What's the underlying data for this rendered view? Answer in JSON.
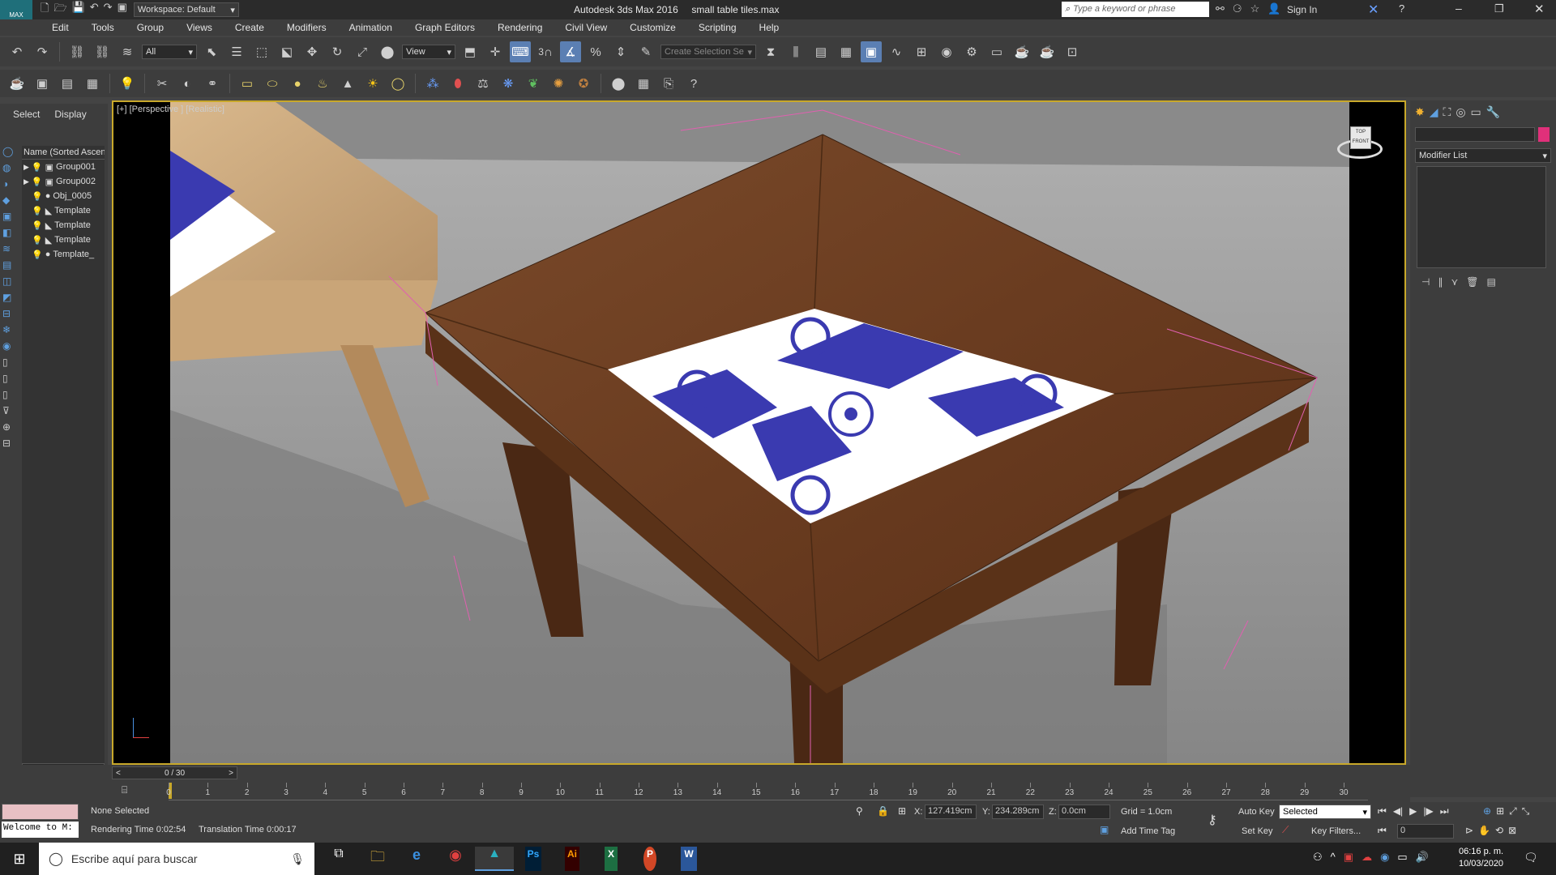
{
  "title_bar": {
    "app_logo_text": "MAX",
    "workspace": "Workspace: Default",
    "app_title": "Autodesk 3ds Max 2016",
    "file_name": "small table tiles.max",
    "search_placeholder": "Type a keyword or phrase",
    "sign_in": "Sign In"
  },
  "menu": [
    "Edit",
    "Tools",
    "Group",
    "Views",
    "Create",
    "Modifiers",
    "Animation",
    "Graph Editors",
    "Rendering",
    "Civil View",
    "Customize",
    "Scripting",
    "Help"
  ],
  "toolbar": {
    "filter_value": "All",
    "ref_coord_value": "View",
    "snap_label": "3",
    "selection_set_placeholder": "Create Selection Se"
  },
  "scene_explorer": {
    "tabs": [
      "Select",
      "Display"
    ],
    "column_header": "Name (Sorted Ascen",
    "items": [
      {
        "label": "Group001",
        "type": "group",
        "expandable": true
      },
      {
        "label": "Group002",
        "type": "group",
        "expandable": true
      },
      {
        "label": "Obj_0005",
        "type": "sphere",
        "expandable": false
      },
      {
        "label": "Template",
        "type": "light",
        "expandable": false
      },
      {
        "label": "Template",
        "type": "light",
        "expandable": false
      },
      {
        "label": "Template",
        "type": "light",
        "expandable": false
      },
      {
        "label": "Template_",
        "type": "sphere",
        "expandable": false
      }
    ]
  },
  "viewport": {
    "label": "[+] [Perspective ] [Realistic]",
    "viewcube_top": "TOP",
    "viewcube_front": "FRONT",
    "tile_color": "#3a3ab0",
    "wood_color": "#6a3e22"
  },
  "command_panel": {
    "modifier_list": "Modifier List",
    "color_swatch": "#e0307a"
  },
  "time_slider": {
    "frame_display": "0 / 30",
    "ticks": [
      "0",
      "1",
      "2",
      "3",
      "4",
      "5",
      "6",
      "7",
      "8",
      "9",
      "10",
      "11",
      "12",
      "13",
      "14",
      "15",
      "16",
      "17",
      "18",
      "19",
      "20",
      "21",
      "22",
      "23",
      "24",
      "25",
      "26",
      "27",
      "28",
      "29",
      "30"
    ]
  },
  "status": {
    "maxscript_text": "Welcome to M:",
    "selection": "None Selected",
    "rendering_time": "Rendering Time  0:02:54",
    "translation_time": "Translation Time  0:00:17",
    "x_label": "X:",
    "x_value": "127.419cm",
    "y_label": "Y:",
    "y_value": "234.289cm",
    "z_label": "Z:",
    "z_value": "0.0cm",
    "grid": "Grid = 1.0cm",
    "add_time_tag": "Add Time Tag",
    "auto_key": "Auto Key",
    "set_key": "Set Key",
    "key_selected": "Selected",
    "key_filters": "Key Filters...",
    "current_frame": "0"
  },
  "taskbar": {
    "search_placeholder": "Escribe aquí para buscar",
    "time": "06:16 p. m.",
    "date": "10/03/2020",
    "apps": [
      "task-view",
      "file-explorer",
      "edge",
      "chrome",
      "3ds-max",
      "photoshop",
      "illustrator",
      "excel",
      "powerpoint",
      "word"
    ],
    "ps_label": "Ps",
    "ai_label": "Ai",
    "x_label": "X",
    "p_label": "P",
    "w_label": "W"
  }
}
